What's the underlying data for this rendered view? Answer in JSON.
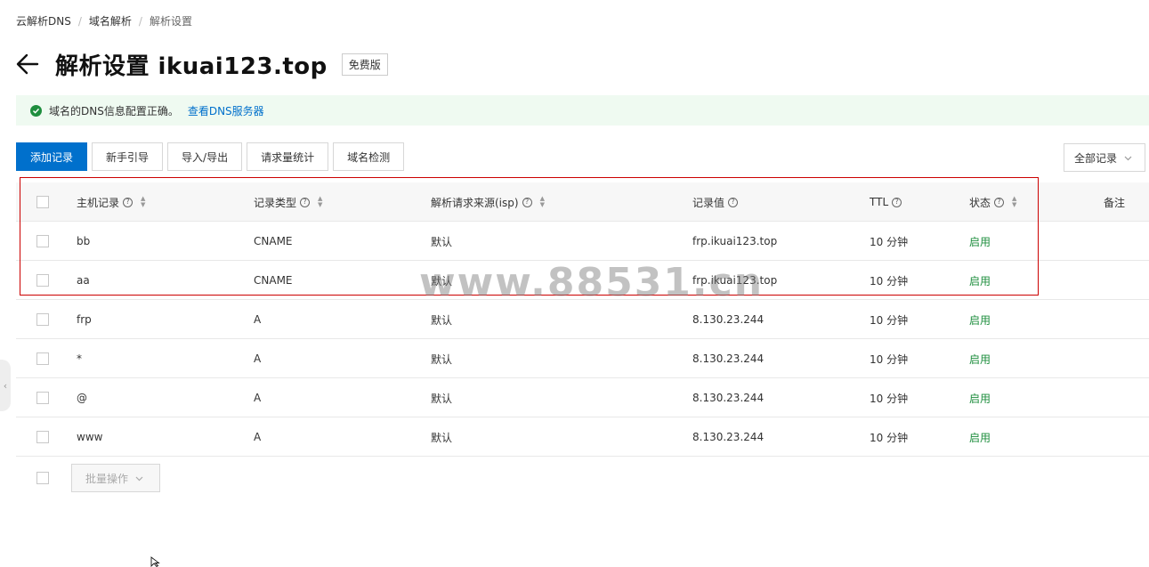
{
  "breadcrumb": {
    "items": [
      "云解析DNS",
      "域名解析",
      "解析设置"
    ],
    "separator": "/"
  },
  "header": {
    "title": "解析设置 ikuai123.top",
    "badge": "免费版"
  },
  "alert": {
    "message": "域名的DNS信息配置正确。",
    "link": "查看DNS服务器"
  },
  "toolbar": {
    "buttons": [
      "添加记录",
      "新手引导",
      "导入/导出",
      "请求量统计",
      "域名检测"
    ],
    "filter": "全部记录"
  },
  "table": {
    "headers": {
      "host": "主机记录",
      "type": "记录类型",
      "isp": "解析请求来源(isp)",
      "value": "记录值",
      "ttl": "TTL",
      "status": "状态",
      "note": "备注"
    },
    "rows": [
      {
        "host": "bb",
        "type": "CNAME",
        "isp": "默认",
        "value": "frp.ikuai123.top",
        "ttl": "10 分钟",
        "status": "启用"
      },
      {
        "host": "aa",
        "type": "CNAME",
        "isp": "默认",
        "value": "frp.ikuai123.top",
        "ttl": "10 分钟",
        "status": "启用"
      },
      {
        "host": "frp",
        "type": "A",
        "isp": "默认",
        "value": "8.130.23.244",
        "ttl": "10 分钟",
        "status": "启用"
      },
      {
        "host": "*",
        "type": "A",
        "isp": "默认",
        "value": "8.130.23.244",
        "ttl": "10 分钟",
        "status": "启用"
      },
      {
        "host": "@",
        "type": "A",
        "isp": "默认",
        "value": "8.130.23.244",
        "ttl": "10 分钟",
        "status": "启用"
      },
      {
        "host": "www",
        "type": "A",
        "isp": "默认",
        "value": "8.130.23.244",
        "ttl": "10 分钟",
        "status": "启用"
      }
    ]
  },
  "bulk": {
    "label": "批量操作"
  },
  "watermark": "www.88531.cn",
  "colors": {
    "primary": "#0070cc",
    "success": "#1e8e3e",
    "alert_bg": "#effaf1",
    "highlight": "#cc0000"
  }
}
